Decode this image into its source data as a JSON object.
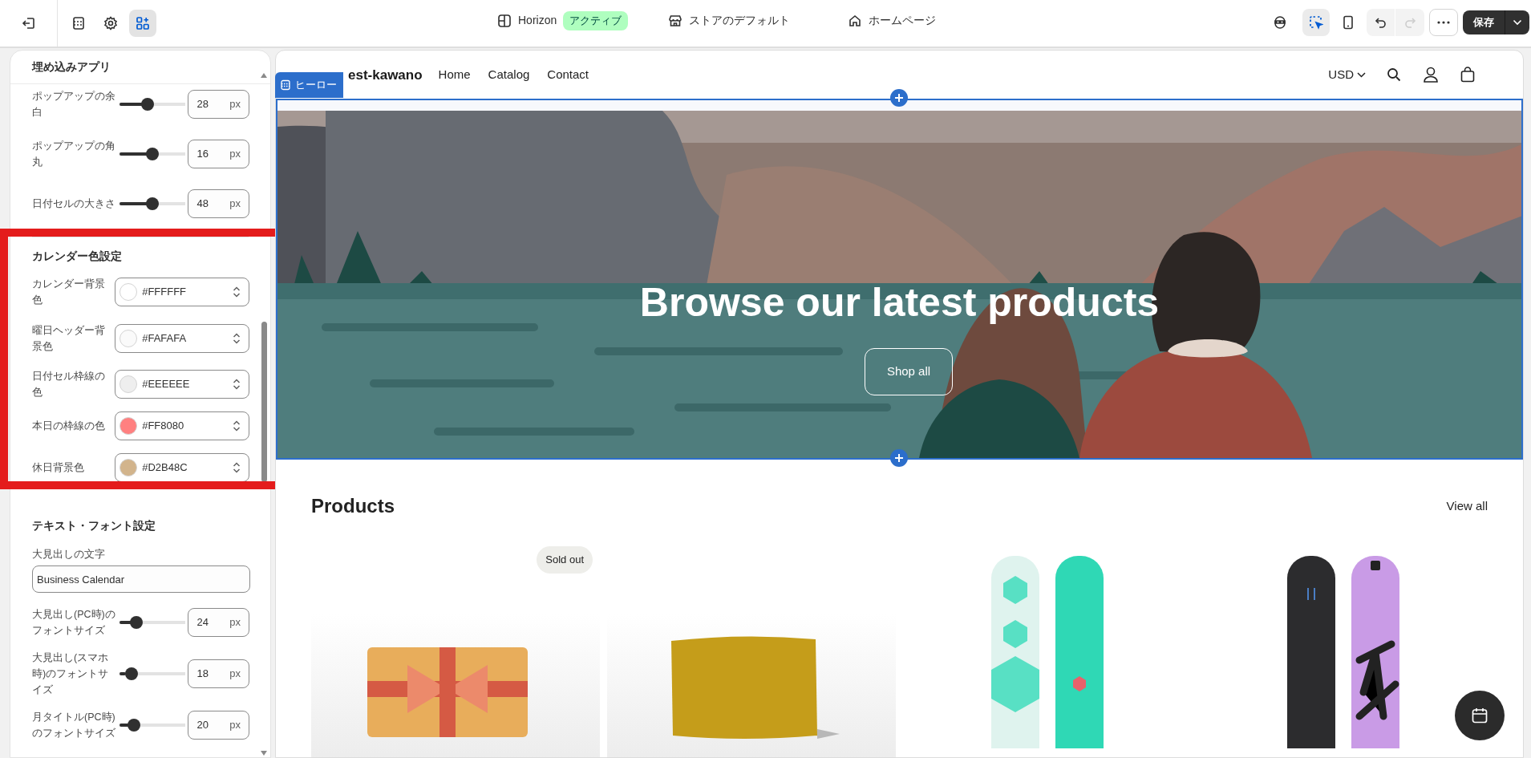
{
  "toolbar": {
    "view_buttons": [
      {
        "kind": "sections",
        "selected": false
      },
      {
        "kind": "settings",
        "selected": false
      },
      {
        "kind": "apps",
        "selected": true
      }
    ],
    "theme": {
      "name": "Horizon",
      "badge": "アクティブ"
    },
    "template": "ストアのデフォルト",
    "page": "ホームページ",
    "inspector": {
      "selected": true
    },
    "redo": {
      "disabled": true
    },
    "save_button": "保存"
  },
  "panel": {
    "title": "埋め込みアプリ",
    "slider_rows": [
      {
        "label": "ポップアップの余白",
        "value": "28",
        "unit": "px",
        "level": 0.4
      },
      {
        "label": "ポップアップの角丸",
        "value": "16",
        "unit": "px",
        "level": 0.5
      },
      {
        "label": "日付セルの大きさ",
        "value": "48",
        "unit": "px",
        "level": 0.5
      }
    ],
    "colors": {
      "title": "カレンダー色設定",
      "rows": [
        {
          "label": "カレンダー背景色",
          "value": "#FFFFFF",
          "color": "#ffffff"
        },
        {
          "label": "曜日ヘッダー背景色",
          "value": "#FAFAFA",
          "color": "#fafafa"
        },
        {
          "label": "日付セル枠線の色",
          "value": "#EEEEEE",
          "color": "#eeeeee"
        },
        {
          "label": "本日の枠線の色",
          "value": "#FF8080",
          "color": "#ff8080"
        },
        {
          "label": "休日背景色",
          "value": "#D2B48C",
          "color": "#d2b48c"
        }
      ]
    },
    "text_section": {
      "title": "テキスト・フォント設定",
      "text_field": {
        "label": "大見出しの文字",
        "value": "Business Calendar"
      },
      "slider_rows": [
        {
          "label": "大見出し(PC時)のフォントサイズ",
          "value": "24",
          "unit": "px",
          "level": 0.2
        },
        {
          "label": "大見出し(スマホ時)のフォントサイズ",
          "value": "18",
          "unit": "px",
          "level": 0.1
        },
        {
          "label": "月タイトル(PC時)のフォントサイズ",
          "value": "20",
          "unit": "px",
          "level": 0.15
        }
      ]
    }
  },
  "preview": {
    "section_tag": "ヒーロー",
    "logo": "est-kawano",
    "nav": [
      "Home",
      "Catalog",
      "Contact"
    ],
    "currency": "USD",
    "hero": {
      "heading": "Browse our latest products",
      "button": "Shop all"
    },
    "products": {
      "title": "Products",
      "view_all": "View all",
      "items": [
        {
          "kind": "gift-card",
          "badge": "Sold out"
        },
        {
          "kind": "wax"
        },
        {
          "kind": "snowboards-green"
        },
        {
          "kind": "snowboards-purple"
        }
      ]
    }
  }
}
